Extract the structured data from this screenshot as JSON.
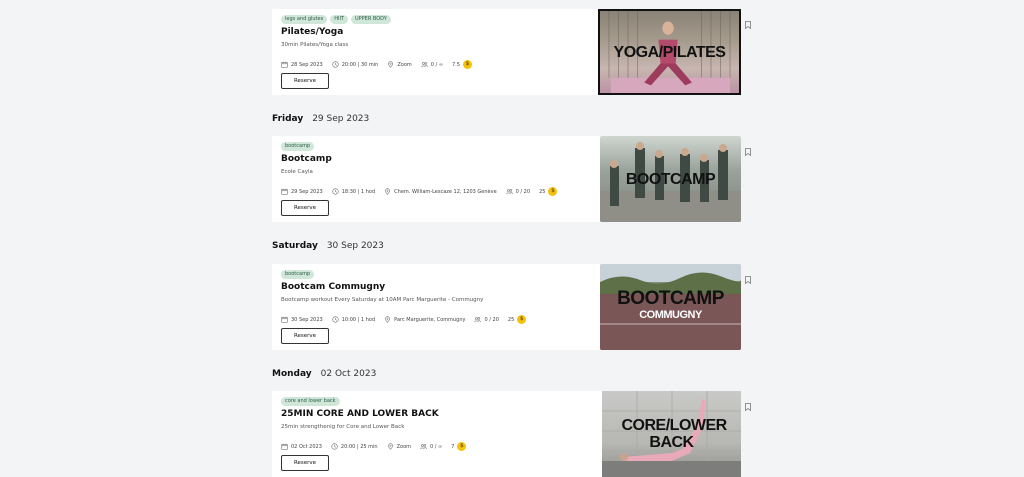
{
  "cards": [
    {
      "tags": [
        "legs and glutes",
        "HIIT",
        "UPPER BODY"
      ],
      "title": "Pilates/Yoga",
      "subtitle": "30min Pilates/Yoga class",
      "date": "28 Sep 2023",
      "time": "20:00 | 30 min",
      "location": "Zoom",
      "capacity": "0 / ∞",
      "price": "7.5",
      "reserve": "Reserve",
      "image_text": "YOGA/PILATES",
      "image_text2": ""
    },
    {
      "tags": [
        "bootcamp"
      ],
      "title": "Bootcamp",
      "subtitle": "Ecole Cayla",
      "date": "29 Sep 2023",
      "time": "18:30 | 1 hod",
      "location": "Chem. William-Lescaze 12, 1203 Genève",
      "capacity": "0 / 20",
      "price": "25",
      "reserve": "Reserve",
      "image_text": "BOOTCAMP",
      "image_text2": ""
    },
    {
      "tags": [
        "bootcamp"
      ],
      "title": "Bootcam Commugny",
      "subtitle": "Bootcamp workout Every Saturday at 10AM Parc Marguerite - Commugny",
      "date": "30 Sep 2023",
      "time": "10:00 | 1 hod",
      "location": "Parc Marguerite, Commugny",
      "capacity": "0 / 20",
      "price": "25",
      "reserve": "Reserve",
      "image_text": "BOOTCAMP",
      "image_text2": "COMMUGNY"
    },
    {
      "tags": [
        "core and lower back"
      ],
      "title": "25MIN CORE AND LOWER BACK",
      "subtitle": "25min strengthenig for Core and Lower Back",
      "date": "02 Oct 2023",
      "time": "20:00 | 25 min",
      "location": "Zoom",
      "capacity": "0 / ∞",
      "price": "7",
      "reserve": "Reserve",
      "image_text": "CORE/LOWER BACK",
      "image_text2": ""
    }
  ],
  "days": [
    {
      "name": "Friday",
      "date": "29 Sep 2023"
    },
    {
      "name": "Saturday",
      "date": "30 Sep 2023"
    },
    {
      "name": "Monday",
      "date": "02 Oct 2023"
    }
  ],
  "colors": {
    "tag_bg": "#cfe6d9",
    "coin": "#f4c20d"
  },
  "icons": {
    "date": "calendar-icon",
    "time": "clock-icon",
    "location": "map-pin-icon",
    "capacity": "people-icon",
    "price": "coin-icon",
    "save": "bookmark-icon"
  }
}
